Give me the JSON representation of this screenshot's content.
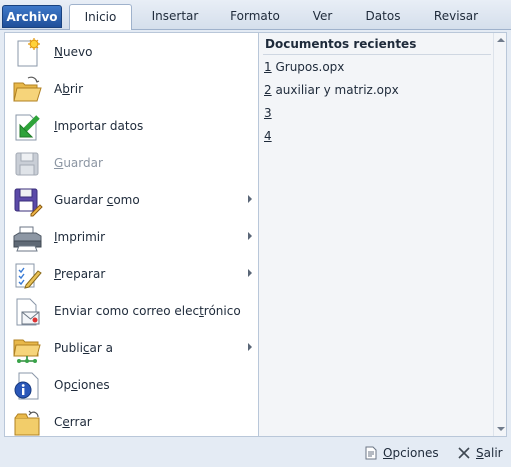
{
  "tabs": [
    {
      "label": "Archivo"
    },
    {
      "label": "Inicio"
    },
    {
      "label": "Insertar"
    },
    {
      "label": "Formato"
    },
    {
      "label": "Ver"
    },
    {
      "label": "Datos"
    },
    {
      "label": "Revisar"
    }
  ],
  "menu": {
    "items": [
      {
        "pre": "",
        "key": "N",
        "post": "uevo",
        "icon": "new-document-icon"
      },
      {
        "pre": "A",
        "key": "b",
        "post": "rir",
        "icon": "open-folder-icon"
      },
      {
        "pre": "",
        "key": "I",
        "post": "mportar datos",
        "icon": "import-data-icon"
      },
      {
        "pre": "",
        "key": "G",
        "post": "uardar",
        "icon": "save-disk-icon"
      },
      {
        "pre": "Guardar ",
        "key": "c",
        "post": "omo",
        "icon": "save-as-icon"
      },
      {
        "pre": "",
        "key": "I",
        "post": "mprimir",
        "icon": "printer-icon"
      },
      {
        "pre": "",
        "key": "P",
        "post": "reparar",
        "icon": "prepare-icon"
      },
      {
        "pre": "Enviar como correo elec",
        "key": "t",
        "post": "rónico",
        "icon": "email-icon"
      },
      {
        "pre": "Publi",
        "key": "c",
        "post": "ar a",
        "icon": "publish-icon"
      },
      {
        "pre": "Op",
        "key": "c",
        "post": "iones",
        "icon": "options-info-icon"
      },
      {
        "pre": "C",
        "key": "e",
        "post": "rrar",
        "icon": "close-folder-icon"
      }
    ]
  },
  "recent": {
    "title": "Documentos recientes",
    "items": [
      {
        "num": "1",
        "name": " Grupos.opx"
      },
      {
        "num": "2",
        "name": " auxiliar y matriz.opx"
      },
      {
        "num": "3",
        "name": ""
      },
      {
        "num": "4",
        "name": ""
      }
    ]
  },
  "bottom": {
    "options_label": "Opciones",
    "options_key": "O",
    "options_rest": "pciones",
    "exit_key": "S",
    "exit_rest": "alir"
  },
  "colors": {
    "file_tab": "#2a5fae",
    "panel_bg": "#e4ebf4",
    "recent_bg": "#f3f5f8"
  }
}
